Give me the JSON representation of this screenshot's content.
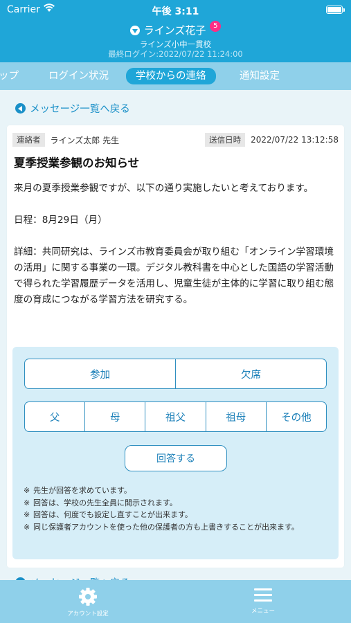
{
  "status_bar": {
    "carrier": "Carrier",
    "time": "午後 3:11"
  },
  "header": {
    "user_name": "ラインズ花子",
    "notification_count": "5",
    "school_name": "ラインズ小中一貫校",
    "last_login": "最終ログイン:2022/07/22 11:24:00",
    "bg_color": "#1fa6d8"
  },
  "tabs": {
    "items": [
      {
        "label": "ップ"
      },
      {
        "label": "ログイン状況"
      },
      {
        "label": "学校からの連絡",
        "active": true
      },
      {
        "label": "通知設定"
      }
    ]
  },
  "back_link": {
    "label": "メッセージ一覧へ戻る"
  },
  "message": {
    "sender_label": "連絡者",
    "sender": "ラインズ太郎 先生",
    "sent_label": "送信日時",
    "sent_at": "2022/07/22 13:12:58",
    "title": "夏季授業参観のお知らせ",
    "paragraphs": [
      "来月の夏季授業参観ですが、以下の通り実施したいと考えております。",
      "日程：8月29日（月）",
      "詳細：共同研究は、ラインズ市教育委員会が取り組む「オンライン学習環境の活用」に関する事業の一環。デジタル教科書を中心とした国語の学習活動で得られた学習履歴データを活用し、児童生徒が主体的に学習に取り組む態度の育成につながる学習方法を研究する。"
    ]
  },
  "answer": {
    "attendance": [
      "参加",
      "欠席"
    ],
    "attendee": [
      "父",
      "母",
      "祖父",
      "祖母",
      "その他"
    ],
    "submit_label": "回答する",
    "notes_mark": "※",
    "notes": [
      "先生が回答を求めています。",
      "回答は、学校の先生全員に開示されます。",
      "回答は、何度でも設定し直すことが出来ます。",
      "同じ保護者アカウントを使った他の保護者の方も上書きすることが出来ます。"
    ]
  },
  "bottom_nav": {
    "account_label": "アカウント設定",
    "account_icon": "gear-icon",
    "menu_label": "メニュー",
    "menu_icon": "menu-icon"
  }
}
